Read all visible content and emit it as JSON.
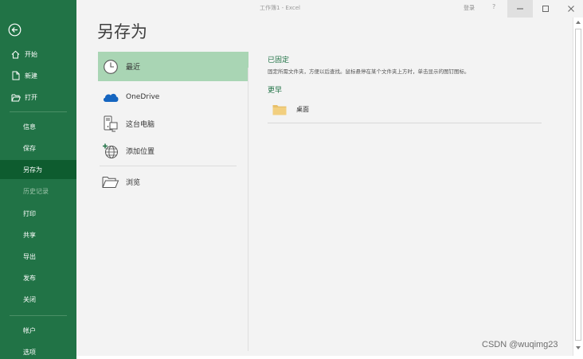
{
  "window": {
    "doc_title": "工作簿1 - Excel",
    "login_label": "登录",
    "help_label": "?"
  },
  "sidebar": {
    "top_items": [
      {
        "label": "开始",
        "icon": "home-icon"
      },
      {
        "label": "新建",
        "icon": "new-doc-icon"
      },
      {
        "label": "打开",
        "icon": "open-folder-icon"
      }
    ],
    "items": [
      {
        "label": "信息"
      },
      {
        "label": "保存"
      },
      {
        "label": "另存为",
        "active": true
      },
      {
        "label": "历史记录",
        "disabled": true
      },
      {
        "label": "打印"
      },
      {
        "label": "共享"
      },
      {
        "label": "导出"
      },
      {
        "label": "发布"
      },
      {
        "label": "关闭"
      }
    ],
    "bottom_items": [
      {
        "label": "帐户"
      },
      {
        "label": "选项"
      }
    ]
  },
  "main": {
    "title": "另存为",
    "locations": [
      {
        "label": "最近",
        "icon": "clock-icon",
        "active": true
      },
      {
        "label": "OneDrive",
        "icon": "cloud-icon"
      },
      {
        "label": "这台电脑",
        "icon": "computer-icon"
      },
      {
        "label": "添加位置",
        "icon": "globe-add-icon"
      }
    ],
    "browse": {
      "label": "浏览",
      "icon": "open-folder-icon"
    },
    "pinned": {
      "heading": "已固定",
      "description": "固定所需文件夹，方便以后查找。鼠标悬停在某个文件夹上方时，单击显示的图钉图标。"
    },
    "earlier": {
      "heading": "更早",
      "folders": [
        {
          "label": "桌面",
          "icon": "folder-icon"
        }
      ]
    }
  },
  "watermark": "CSDN @wuqimg23",
  "colors": {
    "brand": "#217346",
    "active_sidebar": "#0e5c2f",
    "active_location": "#a9d5b4"
  }
}
